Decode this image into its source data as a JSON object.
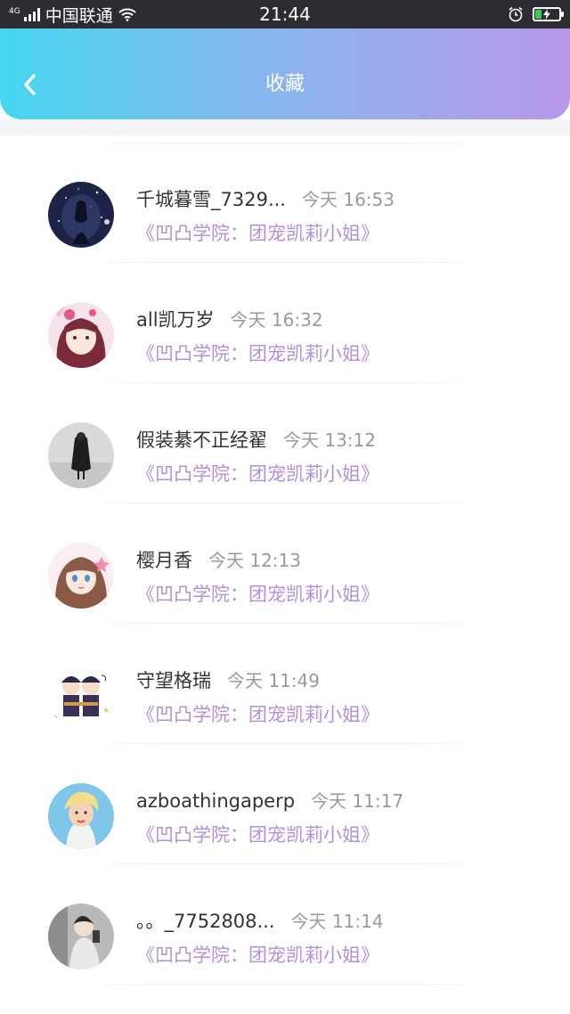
{
  "status_bar": {
    "network": "4G",
    "carrier": "中国联通",
    "time": "21:44",
    "battery_level": 0.24,
    "colors": {
      "bg": "#2b2d33",
      "battery_fill": "#35d14e"
    }
  },
  "header": {
    "title": "收藏",
    "back_icon": "chevron-left-icon",
    "gradient": [
      "#45d6f0",
      "#86b7ef",
      "#b898ea"
    ]
  },
  "favorites": [
    {
      "name": "千城暮雪_7329...",
      "time": "今天 16:53",
      "work": "《凹凸学院：团宠凯莉小姐》"
    },
    {
      "name": "all凯万岁",
      "time": "今天 16:32",
      "work": "《凹凸学院：团宠凯莉小姐》"
    },
    {
      "name": "假装綦不正经翟",
      "time": "今天 13:12",
      "work": "《凹凸学院：团宠凯莉小姐》"
    },
    {
      "name": "樱月香",
      "time": "今天 12:13",
      "work": "《凹凸学院：团宠凯莉小姐》"
    },
    {
      "name": "守望格瑞",
      "time": "今天 11:49",
      "work": "《凹凸学院：团宠凯莉小姐》"
    },
    {
      "name": "azboathingaperp",
      "time": "今天 11:17",
      "work": "《凹凸学院：团宠凯莉小姐》"
    },
    {
      "name": "。。_7752808...",
      "time": "今天 11:14",
      "work": "《凹凸学院：团宠凯莉小姐》"
    }
  ],
  "colors": {
    "name": "#333333",
    "time": "#9a9a9a",
    "work_title": "#b390dc"
  }
}
